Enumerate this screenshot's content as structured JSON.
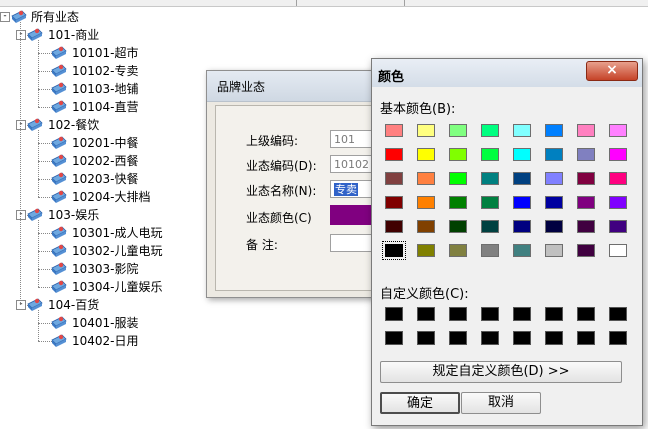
{
  "tree": {
    "root": "所有业态",
    "groups": [
      {
        "label": "101-商业",
        "children": [
          "10101-超市",
          "10102-专卖",
          "10103-地铺",
          "10104-直营"
        ]
      },
      {
        "label": "102-餐饮",
        "children": [
          "10201-中餐",
          "10202-西餐",
          "10203-快餐",
          "10204-大排档"
        ]
      },
      {
        "label": "103-娱乐",
        "children": [
          "10301-成人电玩",
          "10302-儿童电玩",
          "10303-影院",
          "10304-儿童娱乐"
        ]
      },
      {
        "label": "104-百货",
        "children": [
          "10401-服装",
          "10402-日用"
        ]
      }
    ]
  },
  "brand_dialog": {
    "title": "品牌业态",
    "parent_code_label": "上级编码:",
    "parent_code_value": "101",
    "code_label": "业态编码(D):",
    "code_value": "10102",
    "name_label": "业态名称(N):",
    "name_value": "专卖",
    "color_label": "业态颜色(C)",
    "color_value": "#800080",
    "remark_label": "备    注:",
    "remark_value": ""
  },
  "color_dialog": {
    "title": "颜色",
    "close_glyph": "×",
    "basic_label": "基本颜色(B):",
    "basic_colors": [
      [
        "#ff8080",
        "#ffff80",
        "#80ff80",
        "#00ff80",
        "#80ffff",
        "#0080ff",
        "#ff80c0",
        "#ff80ff"
      ],
      [
        "#ff0000",
        "#ffff00",
        "#80ff00",
        "#00ff40",
        "#00ffff",
        "#0080c0",
        "#8080c0",
        "#ff00ff"
      ],
      [
        "#804040",
        "#ff8040",
        "#00ff00",
        "#008080",
        "#004080",
        "#8080ff",
        "#800040",
        "#ff0080"
      ],
      [
        "#800000",
        "#ff8000",
        "#008000",
        "#008040",
        "#0000ff",
        "#0000a0",
        "#800080",
        "#8000ff"
      ],
      [
        "#400000",
        "#804000",
        "#004000",
        "#004040",
        "#000080",
        "#000040",
        "#400040",
        "#400080"
      ],
      [
        "#000000",
        "#808000",
        "#808040",
        "#808080",
        "#408080",
        "#c0c0c0",
        "#400040",
        "#ffffff"
      ]
    ],
    "selected_color": "#000000",
    "custom_label": "自定义颜色(C):",
    "custom_colors": [
      [
        "#000000",
        "#000000",
        "#000000",
        "#000000",
        "#000000",
        "#000000",
        "#000000",
        "#000000"
      ],
      [
        "#000000",
        "#000000",
        "#000000",
        "#000000",
        "#000000",
        "#000000",
        "#000000",
        "#000000"
      ]
    ],
    "define_custom_label": "规定自定义颜色(D) >>",
    "ok_label": "确定",
    "cancel_label": "取消"
  }
}
